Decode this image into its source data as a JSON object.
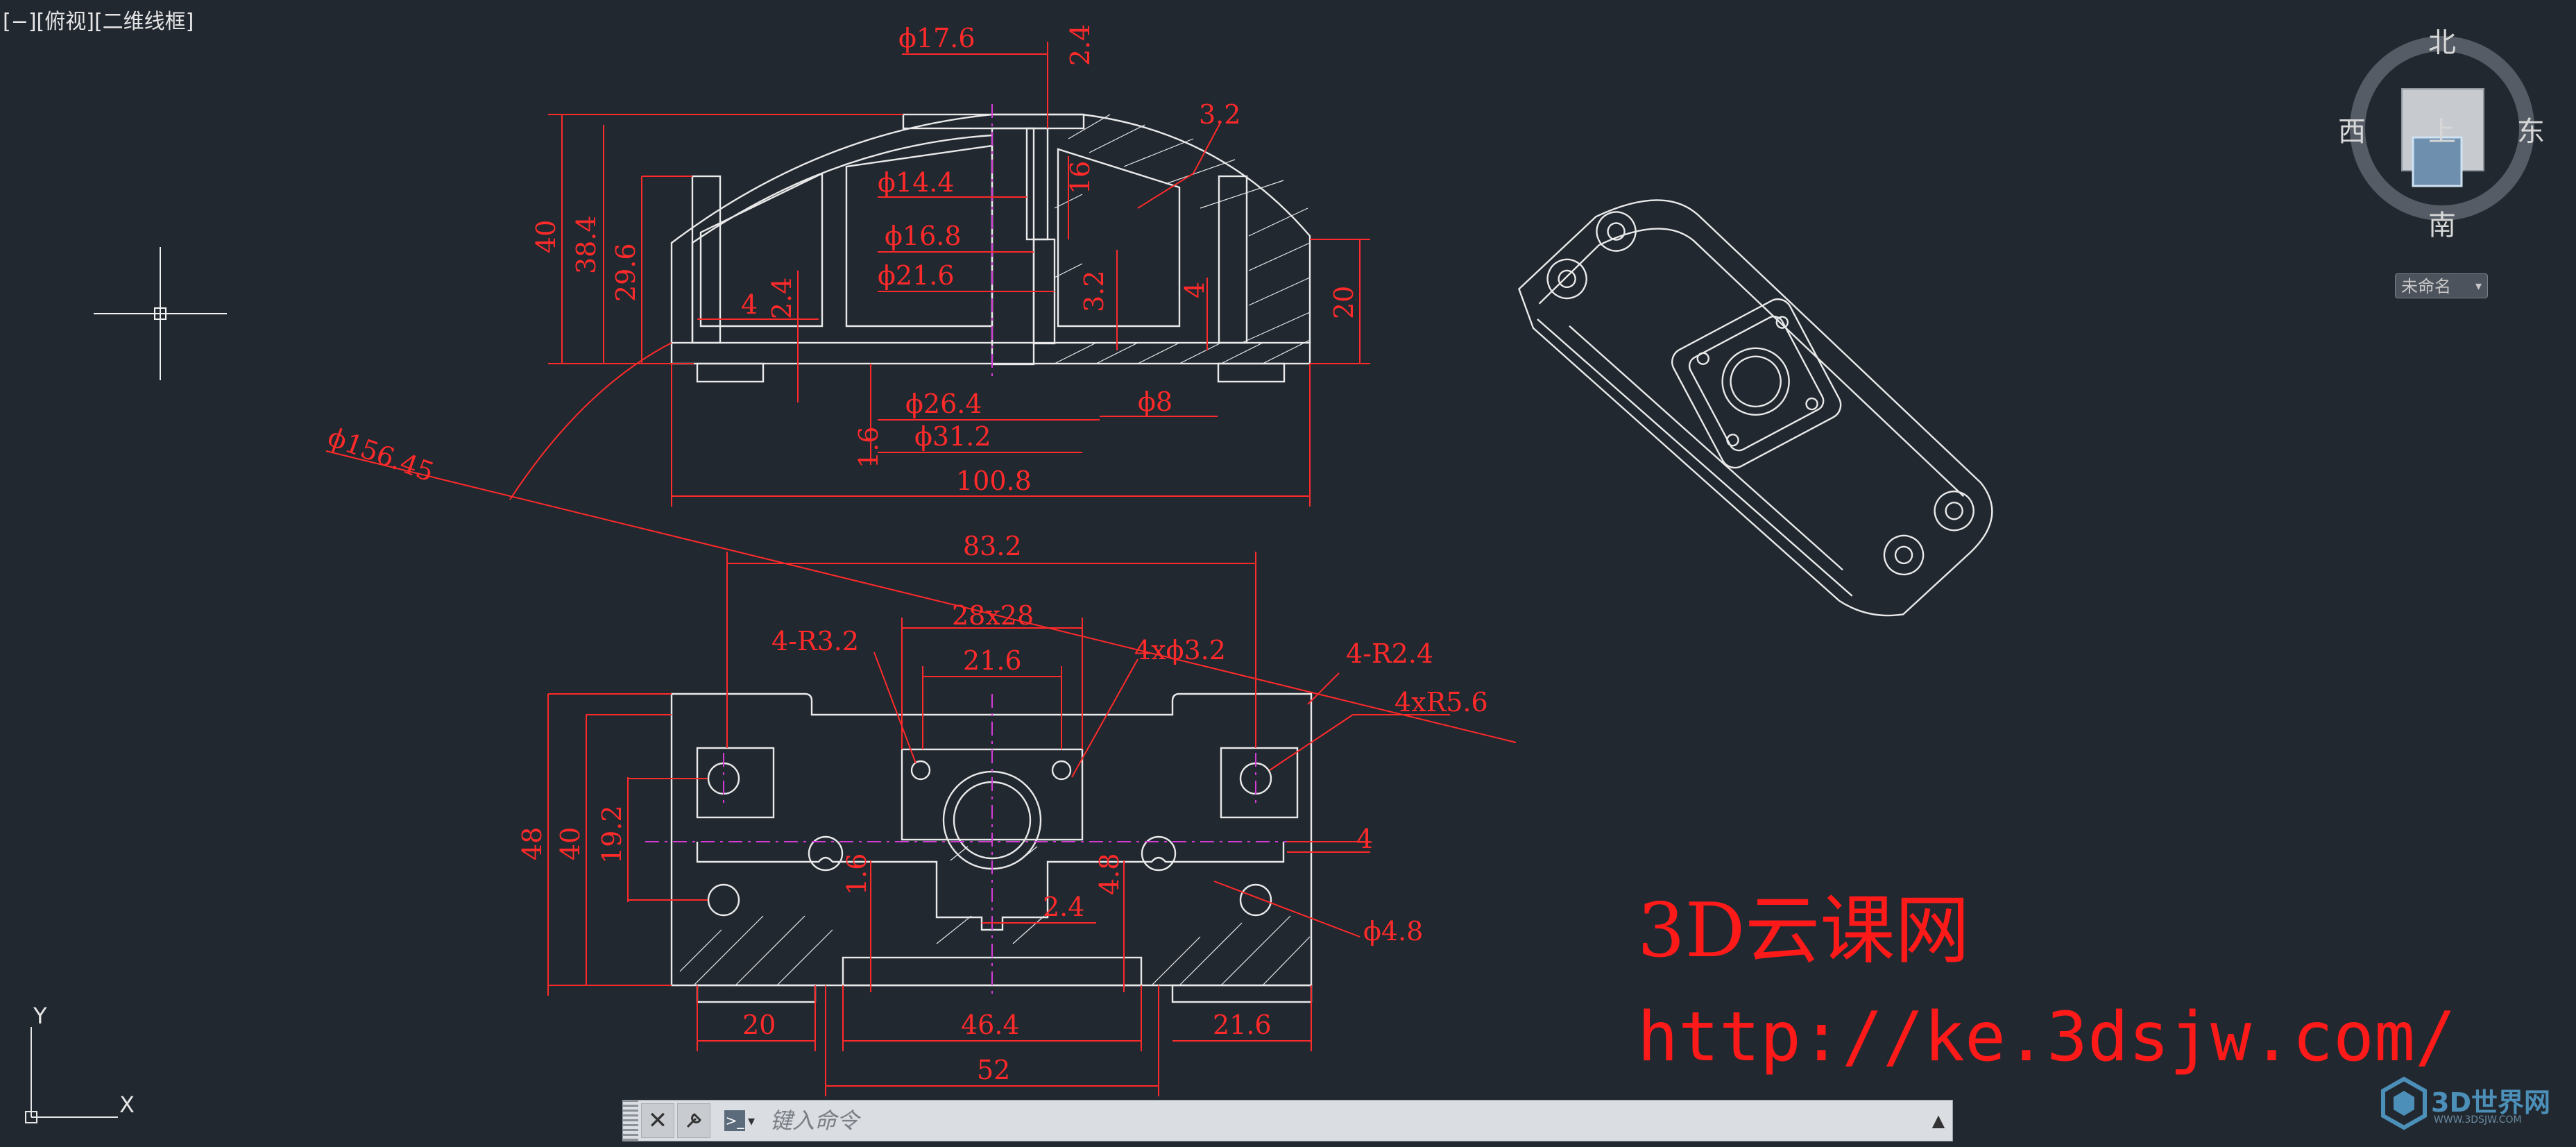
{
  "viewport": {
    "label": "[−][俯视][二维线框]"
  },
  "viewcube": {
    "north": "北",
    "south": "南",
    "east": "东",
    "west": "西",
    "face": "上",
    "named_view": "未命名"
  },
  "dimensions": {
    "top_view": {
      "d17_6": "ϕ17.6",
      "d2_4_top": "2.4",
      "d3_2": "3.2",
      "d14_4": "ϕ14.4",
      "d16_8": "ϕ16.8",
      "d21_6": "ϕ21.6",
      "d16": "16",
      "d3_2b": "3.2",
      "d4": "4",
      "h40": "40",
      "h38_4": "38.4",
      "h29_6": "29.6",
      "w4": "4",
      "w2_4": "2.4",
      "h20": "20",
      "d26_4": "ϕ26.4",
      "d31_2": "ϕ31.2",
      "d8": "ϕ8",
      "h1_6": "1.6",
      "w100_8": "100.8",
      "r156": "ϕ156.45"
    },
    "front_view": {
      "w83_2": "83.2",
      "sq28": "28x28",
      "r3_2": "4-R3.2",
      "w21_6": "21.6",
      "h3_2": "4xϕ3.2",
      "r2_4": "4-R2.4",
      "r5_6": "4xR5.6",
      "h48": "48",
      "h40": "40",
      "h19_2": "19.2",
      "h4": "4",
      "h1_6": "1.6",
      "w2_4": "2.4",
      "h4_8": "4.8",
      "d4_8": "ϕ4.8",
      "w20": "20",
      "w46_4": "46.4",
      "w21_6b": "21.6",
      "w52": "52"
    }
  },
  "watermark": {
    "line1": "3D云课网",
    "line2": "http://ke.3dsjw.com/"
  },
  "logo": {
    "name": "3D世界网",
    "url": "WWW.3DSJW.COM"
  },
  "command": {
    "placeholder": "键入命令",
    "close": "✕",
    "prompt_icon": ">_"
  },
  "colors": {
    "background": "#212830",
    "dimension": "#ff2a2a",
    "geometry": "#e9e9e9",
    "centerline": "#d43bd6"
  }
}
